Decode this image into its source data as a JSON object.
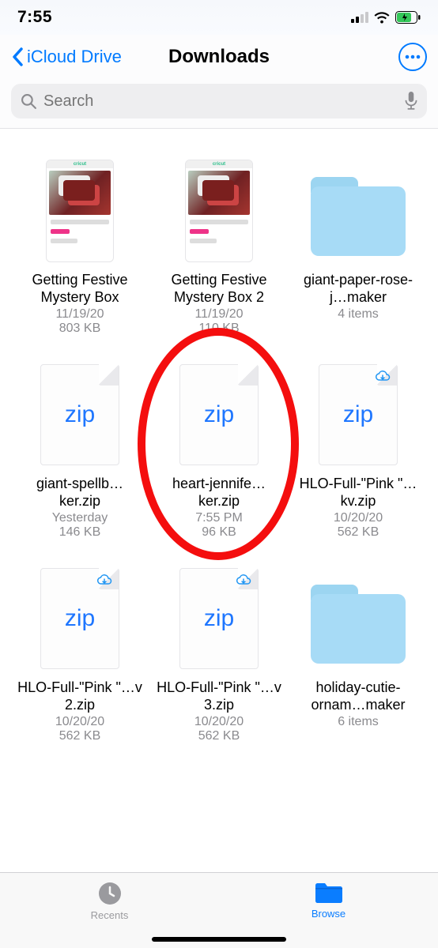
{
  "status": {
    "time": "7:55"
  },
  "nav": {
    "back_label": "iCloud Drive",
    "title": "Downloads"
  },
  "search": {
    "placeholder": "Search"
  },
  "files": [
    {
      "name": "Getting Festive Mystery Box",
      "meta1": "11/19/20",
      "meta2": "803 KB",
      "kind": "page",
      "cloud": false
    },
    {
      "name": "Getting Festive Mystery Box 2",
      "meta1": "11/19/20",
      "meta2": "110 KB",
      "kind": "page",
      "cloud": false
    },
    {
      "name": "giant-paper-rose-j…maker",
      "meta1": "4 items",
      "meta2": "",
      "kind": "folder",
      "cloud": false
    },
    {
      "name": "giant-spellb…ker.zip",
      "meta1": "Yesterday",
      "meta2": "146 KB",
      "kind": "zip",
      "cloud": false
    },
    {
      "name": "heart-jennife…ker.zip",
      "meta1": "7:55 PM",
      "meta2": "96 KB",
      "kind": "zip",
      "cloud": false,
      "circled": true
    },
    {
      "name": "HLO-Full-\"Pink \"…kv.zip",
      "meta1": "10/20/20",
      "meta2": "562 KB",
      "kind": "zip",
      "cloud": true
    },
    {
      "name": "HLO-Full-\"Pink \"…v 2.zip",
      "meta1": "10/20/20",
      "meta2": "562 KB",
      "kind": "zip",
      "cloud": true
    },
    {
      "name": "HLO-Full-\"Pink \"…v 3.zip",
      "meta1": "10/20/20",
      "meta2": "562 KB",
      "kind": "zip",
      "cloud": true
    },
    {
      "name": "holiday-cutie-ornam…maker",
      "meta1": "6 items",
      "meta2": "",
      "kind": "folder",
      "cloud": false
    }
  ],
  "tabs": {
    "recents": "Recents",
    "browse": "Browse"
  },
  "icons": {
    "zip_label": "zip",
    "page_brand": "cricut"
  }
}
